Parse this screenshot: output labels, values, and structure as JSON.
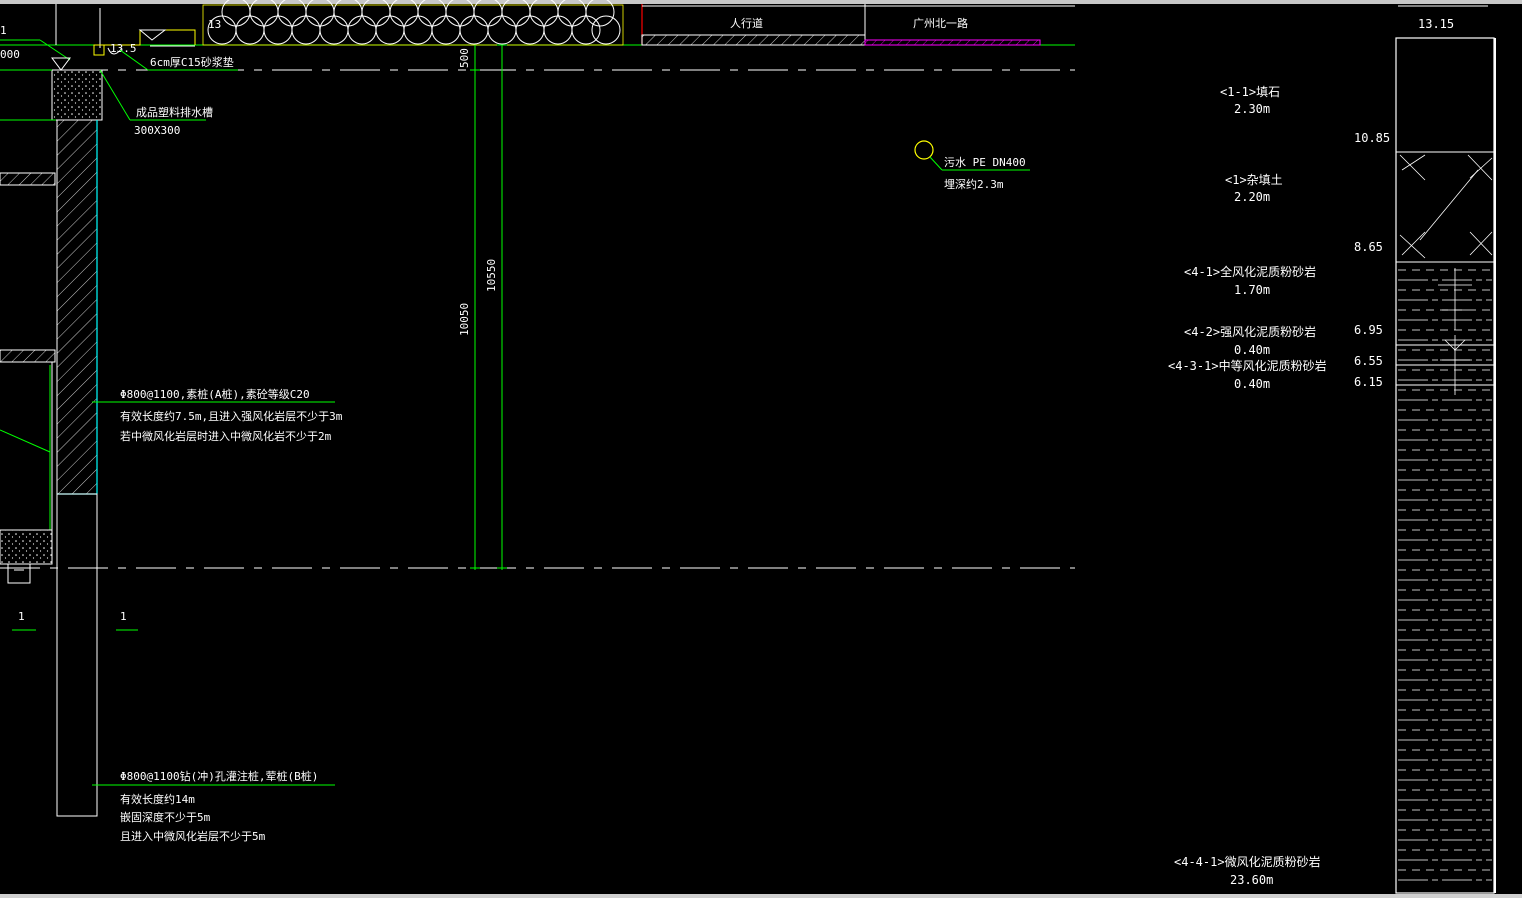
{
  "colors": {
    "background": "#000000",
    "green": "#00ff00",
    "white": "#ffffff",
    "cyan": "#00ffff",
    "yellow": "#ffff00",
    "magenta": "#ff00ff",
    "red": "#ff0000"
  },
  "top_labels": {
    "elev_left": "13.5",
    "elev_mid": "13",
    "sidewalk": "人行道",
    "road": "广州北一路",
    "sand_layer": "6cm厚C15砂浆垫",
    "left_cut_a": "1",
    "left_cut_b": "000"
  },
  "drain": {
    "title": "成品塑料排水槽",
    "size": "300X300"
  },
  "dims": {
    "d500": "500",
    "d10550": "10550",
    "d10050": "10050"
  },
  "pipe": {
    "name": "污水 PE DN400",
    "depth": "埋深约2.3m"
  },
  "pile_a": {
    "title": "Φ800@1100,素桩(A桩),素砼等级C20",
    "line1": "有效长度约7.5m,且进入强风化岩层不少于3m",
    "line2": "若中微风化岩层时进入中微风化岩不少于2m"
  },
  "pile_b": {
    "title": "Φ800@1100钻(冲)孔灌注桩,荤桩(B桩)",
    "line1": "有效长度约14m",
    "line2": "嵌固深度不少于5m",
    "line3": "且进入中微风化岩层不少于5m"
  },
  "section_marks": [
    "1",
    "1"
  ],
  "strata": [
    {
      "name": "<1-1>填石",
      "thickness": "2.30m"
    },
    {
      "name": "<1>杂填土",
      "thickness": "2.20m"
    },
    {
      "name": "<4-1>全风化泥质粉砂岩",
      "thickness": "1.70m"
    },
    {
      "name": "<4-2>强风化泥质粉砂岩",
      "thickness": "0.40m"
    },
    {
      "name": "<4-3-1>中等风化泥质粉砂岩",
      "thickness": "0.40m"
    },
    {
      "name": "<4-4-1>微风化泥质粉砂岩",
      "thickness": "23.60m"
    }
  ],
  "elevations": [
    "13.15",
    "10.85",
    "8.65",
    "6.95",
    "6.55",
    "6.15"
  ]
}
